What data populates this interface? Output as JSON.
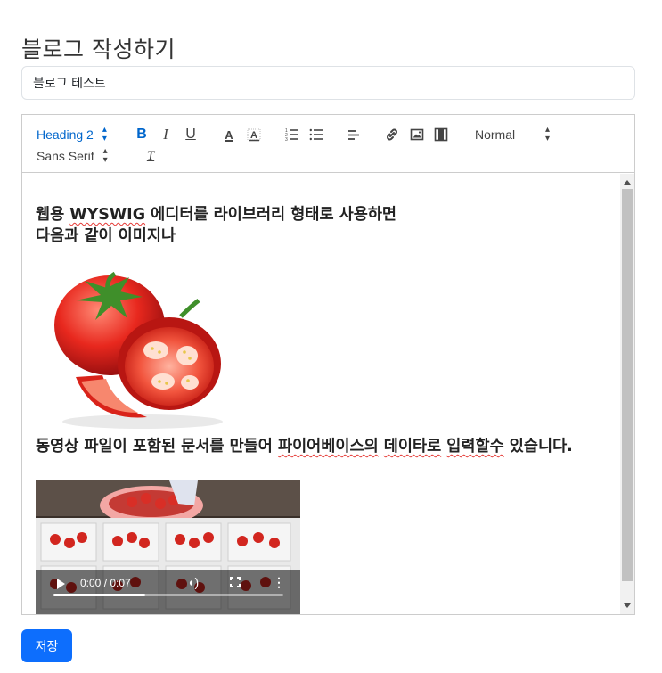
{
  "page": {
    "title": "블로그 작성하기"
  },
  "form": {
    "title_value": "블로그 테스트"
  },
  "toolbar": {
    "header_select": "Heading 2",
    "size_select": "Normal",
    "font_select": "Sans Serif",
    "bold": "B",
    "italic": "I",
    "underline": "U",
    "color": "A",
    "background": "A",
    "clean": "T"
  },
  "content": {
    "para1_line1_prefix": "웹용 ",
    "para1_line1_spell": "WYSWIG",
    "para1_line1_suffix": " 에디터를 라이브러리 형태로 사용하면",
    "para1_line2": "다음과 같이 이미지나",
    "para2_a": "동영상 파일이 포함된 문서를 만들어 ",
    "para2_spell1": "파이어베이스의",
    "para2_b": " ",
    "para2_spell2": "데이타로",
    "para2_c": " ",
    "para2_spell3": "입력할수",
    "para2_d": " 있습니다."
  },
  "video": {
    "time": "0:00 / 0:07",
    "progress": 0.4
  },
  "buttons": {
    "save": "저장"
  },
  "colors": {
    "accent": "#0d6efd",
    "toolbar_active": "#0066cc"
  },
  "icons": [
    "chevron-updown-icon",
    "ordered-list-icon",
    "bullet-list-icon",
    "align-icon",
    "link-icon",
    "image-icon",
    "video-icon",
    "clear-format-icon",
    "play-icon",
    "volume-icon",
    "fullscreen-icon",
    "more-icon"
  ]
}
